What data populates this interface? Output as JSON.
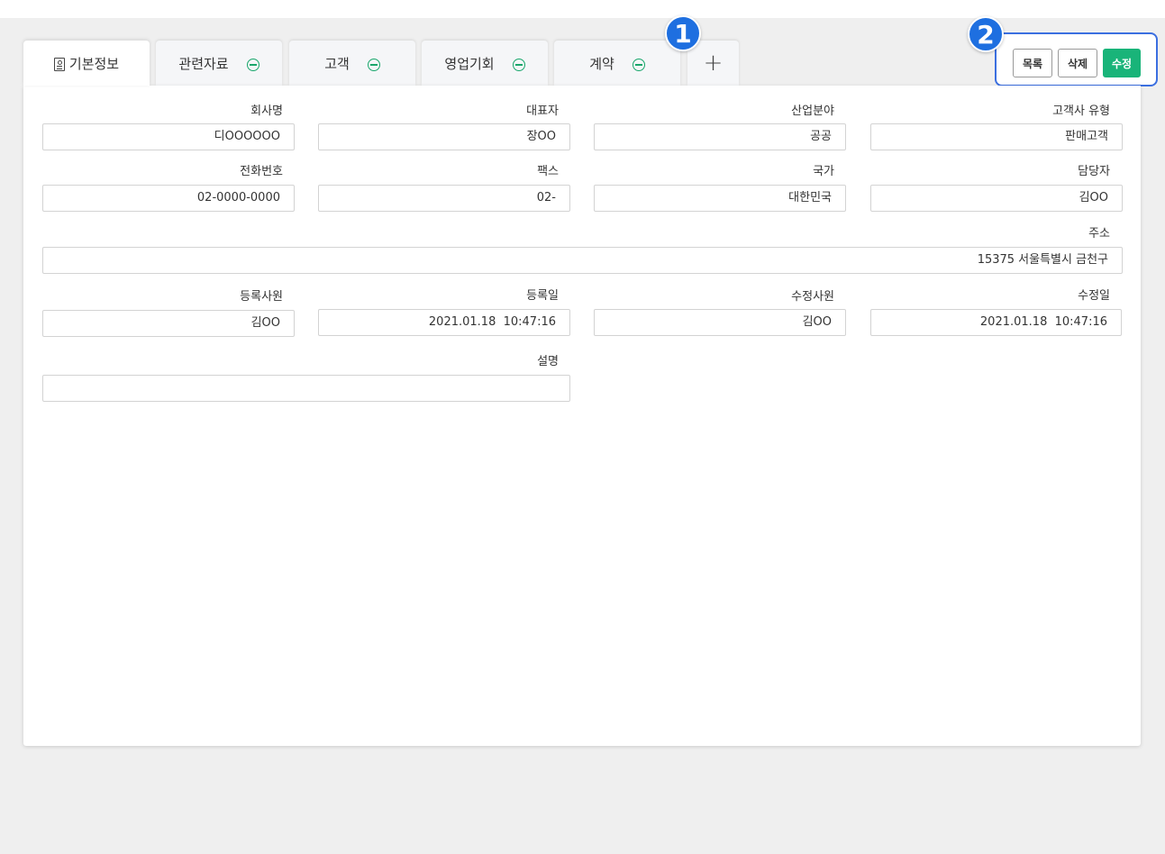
{
  "tabs": [
    {
      "label": "기본정보"
    },
    {
      "label": "관련자료"
    },
    {
      "label": "고객"
    },
    {
      "label": "영업기회"
    },
    {
      "label": "계약"
    },
    {
      "label": "+"
    }
  ],
  "badges": {
    "one": "1",
    "two": "2"
  },
  "actions": {
    "list": "목록",
    "delete": "삭제",
    "edit": "수정"
  },
  "fields": {
    "company": {
      "label": "회사명",
      "value": "디OOOOOO"
    },
    "ceo": {
      "label": "대표자",
      "value": "장OO"
    },
    "industry": {
      "label": "산업분야",
      "value": "공공"
    },
    "customer_type": {
      "label": "고객사 유형",
      "value": "판매고객"
    },
    "phone": {
      "label": "전화번호",
      "value": "02-0000-0000"
    },
    "fax": {
      "label": "팩스",
      "value": "02-"
    },
    "country": {
      "label": "국가",
      "value": "대한민국"
    },
    "manager": {
      "label": "담당자",
      "value": "김OO"
    },
    "address": {
      "label": "주소",
      "value": "15375 서울특별시 금천구"
    },
    "reg_user": {
      "label": "등록사원",
      "value": "김OO"
    },
    "reg_date": {
      "label": "등록일",
      "value": "2021.01.18  10:47:16"
    },
    "mod_user": {
      "label": "수정사원",
      "value": "김OO"
    },
    "mod_date": {
      "label": "수정일",
      "value": "2021.01.18  10:47:16"
    },
    "description": {
      "label": "설명",
      "value": ""
    }
  },
  "colors": {
    "accent": "#19b479",
    "badge": "#1e6fe0",
    "highlight_border": "#3b6fe0"
  }
}
